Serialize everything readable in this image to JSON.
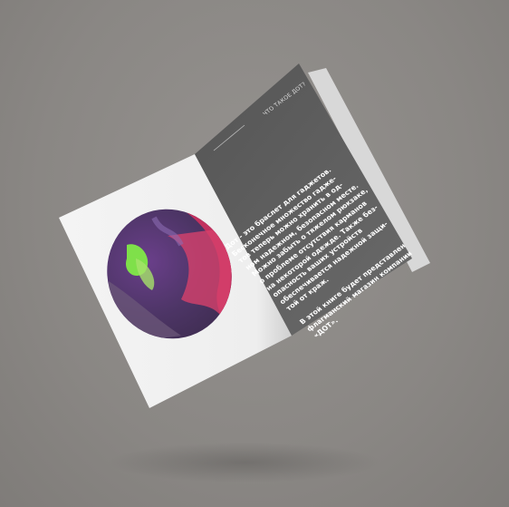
{
  "booklet": {
    "header": "ЧТО ТАКОЕ ДОТ?",
    "paragraph1": [
      "Дот - это браслет для гаджетов.",
      "Бесконечное множество гадже-",
      "тов теперь можно хранить в од-",
      "ном надежном, безопасном месте.",
      "Можно забыть о тяжелом рюкзаке,",
      "о проблеме отсутствия карманов",
      "на некоторой одежде. Также без-",
      "опасность ваших устройств",
      "обеспечивается надежной защи-",
      "той от краж."
    ],
    "paragraph2": [
      "В этой книге будет представлен",
      "флагманский магазин компании",
      "«ДОТ»."
    ]
  },
  "colors": {
    "background": "#8a8784",
    "left_page": "#f2f2f2",
    "right_page": "#5f5f5f"
  }
}
